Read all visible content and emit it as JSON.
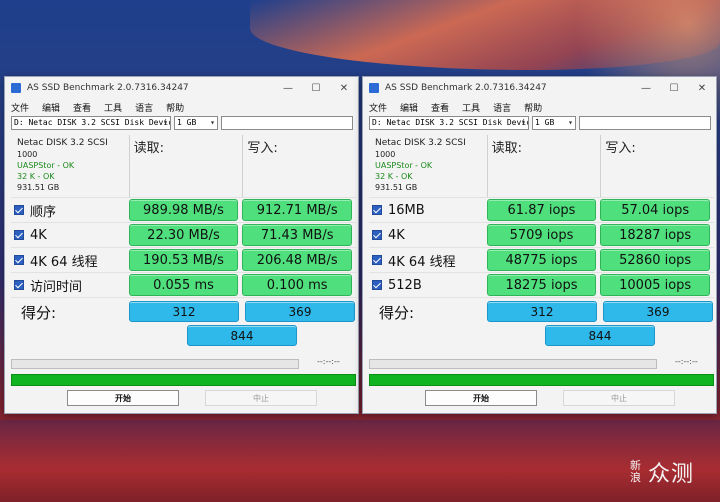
{
  "windows": [
    {
      "title": "AS SSD Benchmark 2.0.7316.34247",
      "controls": {
        "minimize": "—",
        "maximize": "☐",
        "close": "✕"
      },
      "menu": [
        "文件",
        "编辑",
        "查看",
        "工具",
        "语言",
        "帮助"
      ],
      "drive_select": "D: Netac DISK 3.2 SCSI Disk Devic",
      "size_select": "1 GB",
      "info": {
        "name": "Netac DISK 3.2 SCSI",
        "fw": "1000",
        "driver": "UASPStor - OK",
        "align": "32 K - OK",
        "capacity": "931.51 GB"
      },
      "columns": {
        "read": "读取:",
        "write": "写入:"
      },
      "rows": [
        {
          "label": "顺序",
          "read": "989.98 MB/s",
          "write": "912.71 MB/s"
        },
        {
          "label": "4K",
          "read": "22.30 MB/s",
          "write": "71.43 MB/s"
        },
        {
          "label": "4K 64 线程",
          "read": "190.53 MB/s",
          "write": "206.48 MB/s"
        },
        {
          "label": "访问时间",
          "read": "0.055 ms",
          "write": "0.100 ms"
        }
      ],
      "score": {
        "label": "得分:",
        "read": "312",
        "write": "369",
        "total": "844"
      },
      "time": "--:--:--",
      "start": "开始",
      "stop": "中止"
    },
    {
      "title": "AS SSD Benchmark 2.0.7316.34247",
      "controls": {
        "minimize": "—",
        "maximize": "☐",
        "close": "✕"
      },
      "menu": [
        "文件",
        "编辑",
        "查看",
        "工具",
        "语言",
        "帮助"
      ],
      "drive_select": "D: Netac DISK 3.2 SCSI Disk Devic",
      "size_select": "1 GB",
      "info": {
        "name": "Netac DISK 3.2 SCSI",
        "fw": "1000",
        "driver": "UASPStor - OK",
        "align": "32 K - OK",
        "capacity": "931.51 GB"
      },
      "columns": {
        "read": "读取:",
        "write": "写入:"
      },
      "rows": [
        {
          "label": "16MB",
          "read": "61.87 iops",
          "write": "57.04 iops"
        },
        {
          "label": "4K",
          "read": "5709 iops",
          "write": "18287 iops"
        },
        {
          "label": "4K 64 线程",
          "read": "48775 iops",
          "write": "52860 iops"
        },
        {
          "label": "512B",
          "read": "18275 iops",
          "write": "10005 iops"
        }
      ],
      "score": {
        "label": "得分:",
        "read": "312",
        "write": "369",
        "total": "844"
      },
      "time": "--:--:--",
      "start": "开始",
      "stop": "中止"
    }
  ],
  "watermark": {
    "small": "新浪",
    "main": "众测"
  },
  "colors": {
    "result_cell": "#4fe07d",
    "score_cell": "#2fb8ea",
    "progress": "#10b320",
    "checkbox": "#2c5fbf"
  }
}
